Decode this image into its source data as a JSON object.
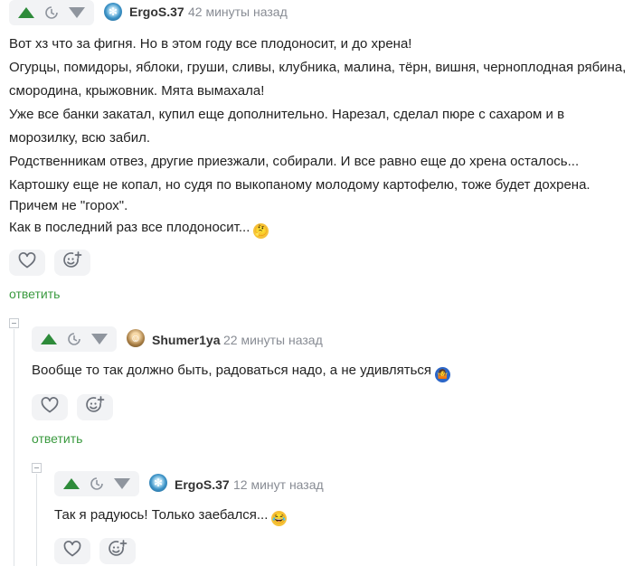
{
  "comments": [
    {
      "username": "ErgoS.37",
      "time": "42 минуты назад",
      "lines": [
        "Вот хз что за фигня. Но в этом году все плодоносит, и до хрена!",
        "Огурцы, помидоры, яблоки, груши, сливы, клубника, малина, тёрн, вишня, черноплодная рябина,",
        "смородина, крыжовник. Мята вымахала!",
        "Уже все банки закатал, купил еще дополнительно. Нарезал, сделал пюре с сахаром и в",
        "морозилку, всю забил.",
        "Родственникам отвез, другие приезжали, собирали. И все равно еще до хрена осталось...",
        "Картошку еще не копал, но судя по выкопаному молодому картофелю, тоже будет дохрена.",
        "Причем не \"горох\".",
        "Как в последний раз все плодоносит..."
      ],
      "reply_label": "ответить"
    },
    {
      "username": "Shumer1ya",
      "time": "22 минуты назад",
      "lines": [
        "Вообще то так должно быть, радоваться надо, а не удивляться"
      ],
      "reply_label": "ответить"
    },
    {
      "username": "ErgoS.37",
      "time": "12 минут назад",
      "lines": [
        "Так я радуюсь! Только заебался..."
      ]
    }
  ],
  "icons": {
    "upvote": "triangle-up-icon",
    "save": "clock-icon",
    "downvote": "triangle-down-icon",
    "like": "heart-icon",
    "react": "smile-plus-icon"
  },
  "colors": {
    "accent": "#2e8b3a",
    "reply": "#3a9a3f",
    "meta": "#888c94"
  }
}
